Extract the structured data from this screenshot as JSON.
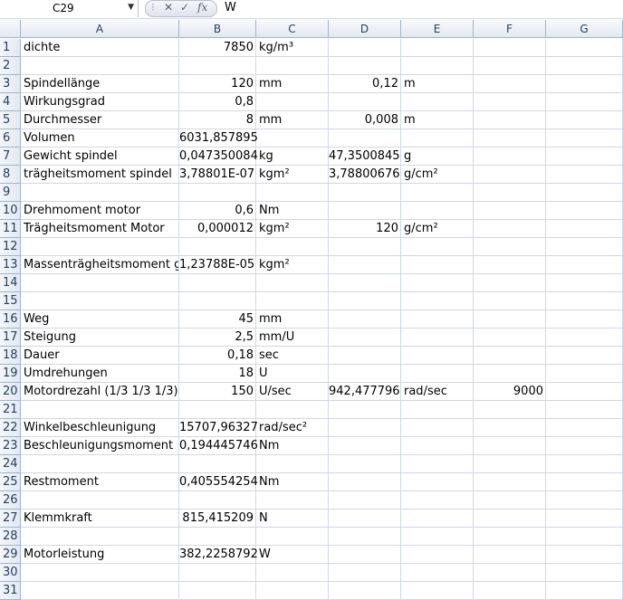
{
  "formula_bar": {
    "name_box": "C29",
    "content": "W"
  },
  "columns": [
    "A",
    "B",
    "C",
    "D",
    "E",
    "F",
    "G"
  ],
  "rows": [
    {
      "n": "1",
      "A": "dichte",
      "B": "7850",
      "C": "kg/m³"
    },
    {
      "n": "2"
    },
    {
      "n": "3",
      "A": "Spindellänge",
      "B": "120",
      "C": "mm",
      "D": "0,12",
      "E": "m"
    },
    {
      "n": "4",
      "A": "Wirkungsgrad",
      "B": "0,8"
    },
    {
      "n": "5",
      "A": "Durchmesser",
      "B": "8",
      "C": "mm",
      "D": "0,008",
      "E": "m"
    },
    {
      "n": "6",
      "A": "Volumen",
      "B": "6031,857895"
    },
    {
      "n": "7",
      "A": "Gewicht spindel",
      "B": "0,047350084",
      "C": "kg",
      "D": "47,3500845",
      "E": "g"
    },
    {
      "n": "8",
      "A": "trägheitsmoment spindel",
      "B": "3,78801E-07",
      "C": "kgm²",
      "D": "3,78800676",
      "E": "g/cm²"
    },
    {
      "n": "9"
    },
    {
      "n": "10",
      "A": "Drehmoment motor",
      "B": "0,6",
      "C": "Nm"
    },
    {
      "n": "11",
      "A": "Trägheitsmoment Motor",
      "B": "0,000012",
      "C": "kgm²",
      "D": "120",
      "E": "g/cm²"
    },
    {
      "n": "12"
    },
    {
      "n": "13",
      "A": "Massenträgheitsmoment ge",
      "B": "1,23788E-05",
      "C": "kgm²"
    },
    {
      "n": "14"
    },
    {
      "n": "15"
    },
    {
      "n": "16",
      "A": "Weg",
      "B": "45",
      "C": "mm"
    },
    {
      "n": "17",
      "A": "Steigung",
      "B": "2,5",
      "C": "mm/U"
    },
    {
      "n": "18",
      "A": "Dauer",
      "B": "0,18",
      "C": "sec"
    },
    {
      "n": "19",
      "A": "Umdrehungen",
      "B": "18",
      "C": "U"
    },
    {
      "n": "20",
      "A": "Motordrezahl (1/3 1/3 1/3)",
      "B": "150",
      "C": "U/sec",
      "D": "942,477796",
      "E": "rad/sec",
      "F": "9000"
    },
    {
      "n": "21"
    },
    {
      "n": "22",
      "A": "Winkelbeschleunigung",
      "B": "15707,96327",
      "C": "rad/sec²"
    },
    {
      "n": "23",
      "A": "Beschleunigungsmoment",
      "B": "0,194445746",
      "C": "Nm"
    },
    {
      "n": "24"
    },
    {
      "n": "25",
      "A": "Restmoment",
      "B": "0,405554254",
      "C": "Nm"
    },
    {
      "n": "26"
    },
    {
      "n": "27",
      "A": "Klemmkraft",
      "B": "815,415209",
      "C": "N"
    },
    {
      "n": "28"
    },
    {
      "n": "29",
      "A": "Motorleistung",
      "B": "382,2258792",
      "C": "W"
    },
    {
      "n": "30"
    },
    {
      "n": "31"
    }
  ]
}
